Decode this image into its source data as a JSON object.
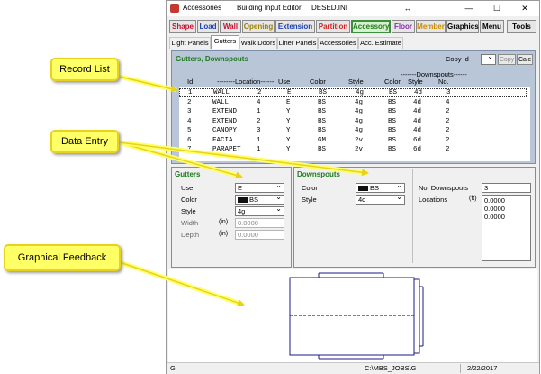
{
  "window": {
    "titles": [
      "Accessories",
      "Building Input Editor",
      "DESED.INI"
    ],
    "controls": [
      "↔",
      "—",
      "☐",
      "✕"
    ]
  },
  "modules": [
    {
      "label": "Shape",
      "color": "#c8102e"
    },
    {
      "label": "Load",
      "color": "#1b3fb0"
    },
    {
      "label": "Wall",
      "color": "#c8102e"
    },
    {
      "label": "Opening",
      "color": "#9c7f00"
    },
    {
      "label": "Extension",
      "color": "#1b3fb0"
    },
    {
      "label": "Partition",
      "color": "#d62020"
    },
    {
      "label": "Accessory",
      "color": "#1c7a1c"
    },
    {
      "label": "Floor",
      "color": "#8a2fb0"
    },
    {
      "label": "Member",
      "color": "#c78b00"
    },
    {
      "label": "Graphics",
      "color": "#000000"
    },
    {
      "label": "Menu",
      "color": "#000000"
    },
    {
      "label": "Tools",
      "color": "#000000"
    }
  ],
  "subtabs": [
    "Light Panels",
    "Gutters",
    "Walk Doors",
    "Liner Panels",
    "Accessories",
    "Acc. Estimate"
  ],
  "records": {
    "title": "Gutters, Downspouts",
    "copy_id_label": "Copy Id",
    "copy_button": "Copy",
    "calc_button": "Calc",
    "downspouts_group": "-------Downspouts------",
    "headers": [
      "Id",
      "--------Location------",
      "Use",
      "Color",
      "Style",
      "Color",
      "Style",
      "No."
    ],
    "rows": [
      [
        "1",
        "WALL",
        "2",
        "E",
        "BS",
        "4g",
        "BS",
        "4d",
        "3"
      ],
      [
        "2",
        "WALL",
        "4",
        "E",
        "BS",
        "4g",
        "BS",
        "4d",
        "4"
      ],
      [
        "3",
        "EXTEND",
        "1",
        "Y",
        "BS",
        "4g",
        "BS",
        "4d",
        "2"
      ],
      [
        "4",
        "EXTEND",
        "2",
        "Y",
        "BS",
        "4g",
        "BS",
        "4d",
        "2"
      ],
      [
        "5",
        "CANOPY",
        "3",
        "Y",
        "BS",
        "4g",
        "BS",
        "4d",
        "2"
      ],
      [
        "6",
        "FACIA",
        "1",
        "Y",
        "GM",
        "2v",
        "BS",
        "6d",
        "2"
      ],
      [
        "7",
        "PARAPET",
        "1",
        "Y",
        "BS",
        "2v",
        "BS",
        "6d",
        "2"
      ]
    ]
  },
  "gutters": {
    "title": "Gutters",
    "use_label": "Use",
    "use_value": "E",
    "color_label": "Color",
    "color_value": "BS",
    "style_label": "Style",
    "style_value": "4g",
    "width_label": "Width",
    "width_unit": "(in)",
    "width_value": "0.0000",
    "depth_label": "Depth",
    "depth_unit": "(in)",
    "depth_value": "0.0000"
  },
  "downspouts": {
    "title": "Downspouts",
    "color_label": "Color",
    "color_value": "BS",
    "style_label": "Style",
    "style_value": "4d",
    "no_label": "No. Downspouts",
    "no_value": "3",
    "locations_label": "Locations",
    "locations_unit": "(ft)",
    "locations": [
      "0.0000",
      "0.0000",
      "0.0000"
    ]
  },
  "status": {
    "mode": "G",
    "path": "C:\\MBS_JOBS\\G",
    "date": "2/22/2017"
  },
  "callouts": {
    "record_list": "Record List",
    "data_entry": "Data Entry",
    "graphical_feedback": "Graphical Feedback"
  },
  "colors": {
    "accent_green": "#1c7a1c",
    "callout_yellow": "#ffff66",
    "panel_blue": "#b8c6d8"
  }
}
